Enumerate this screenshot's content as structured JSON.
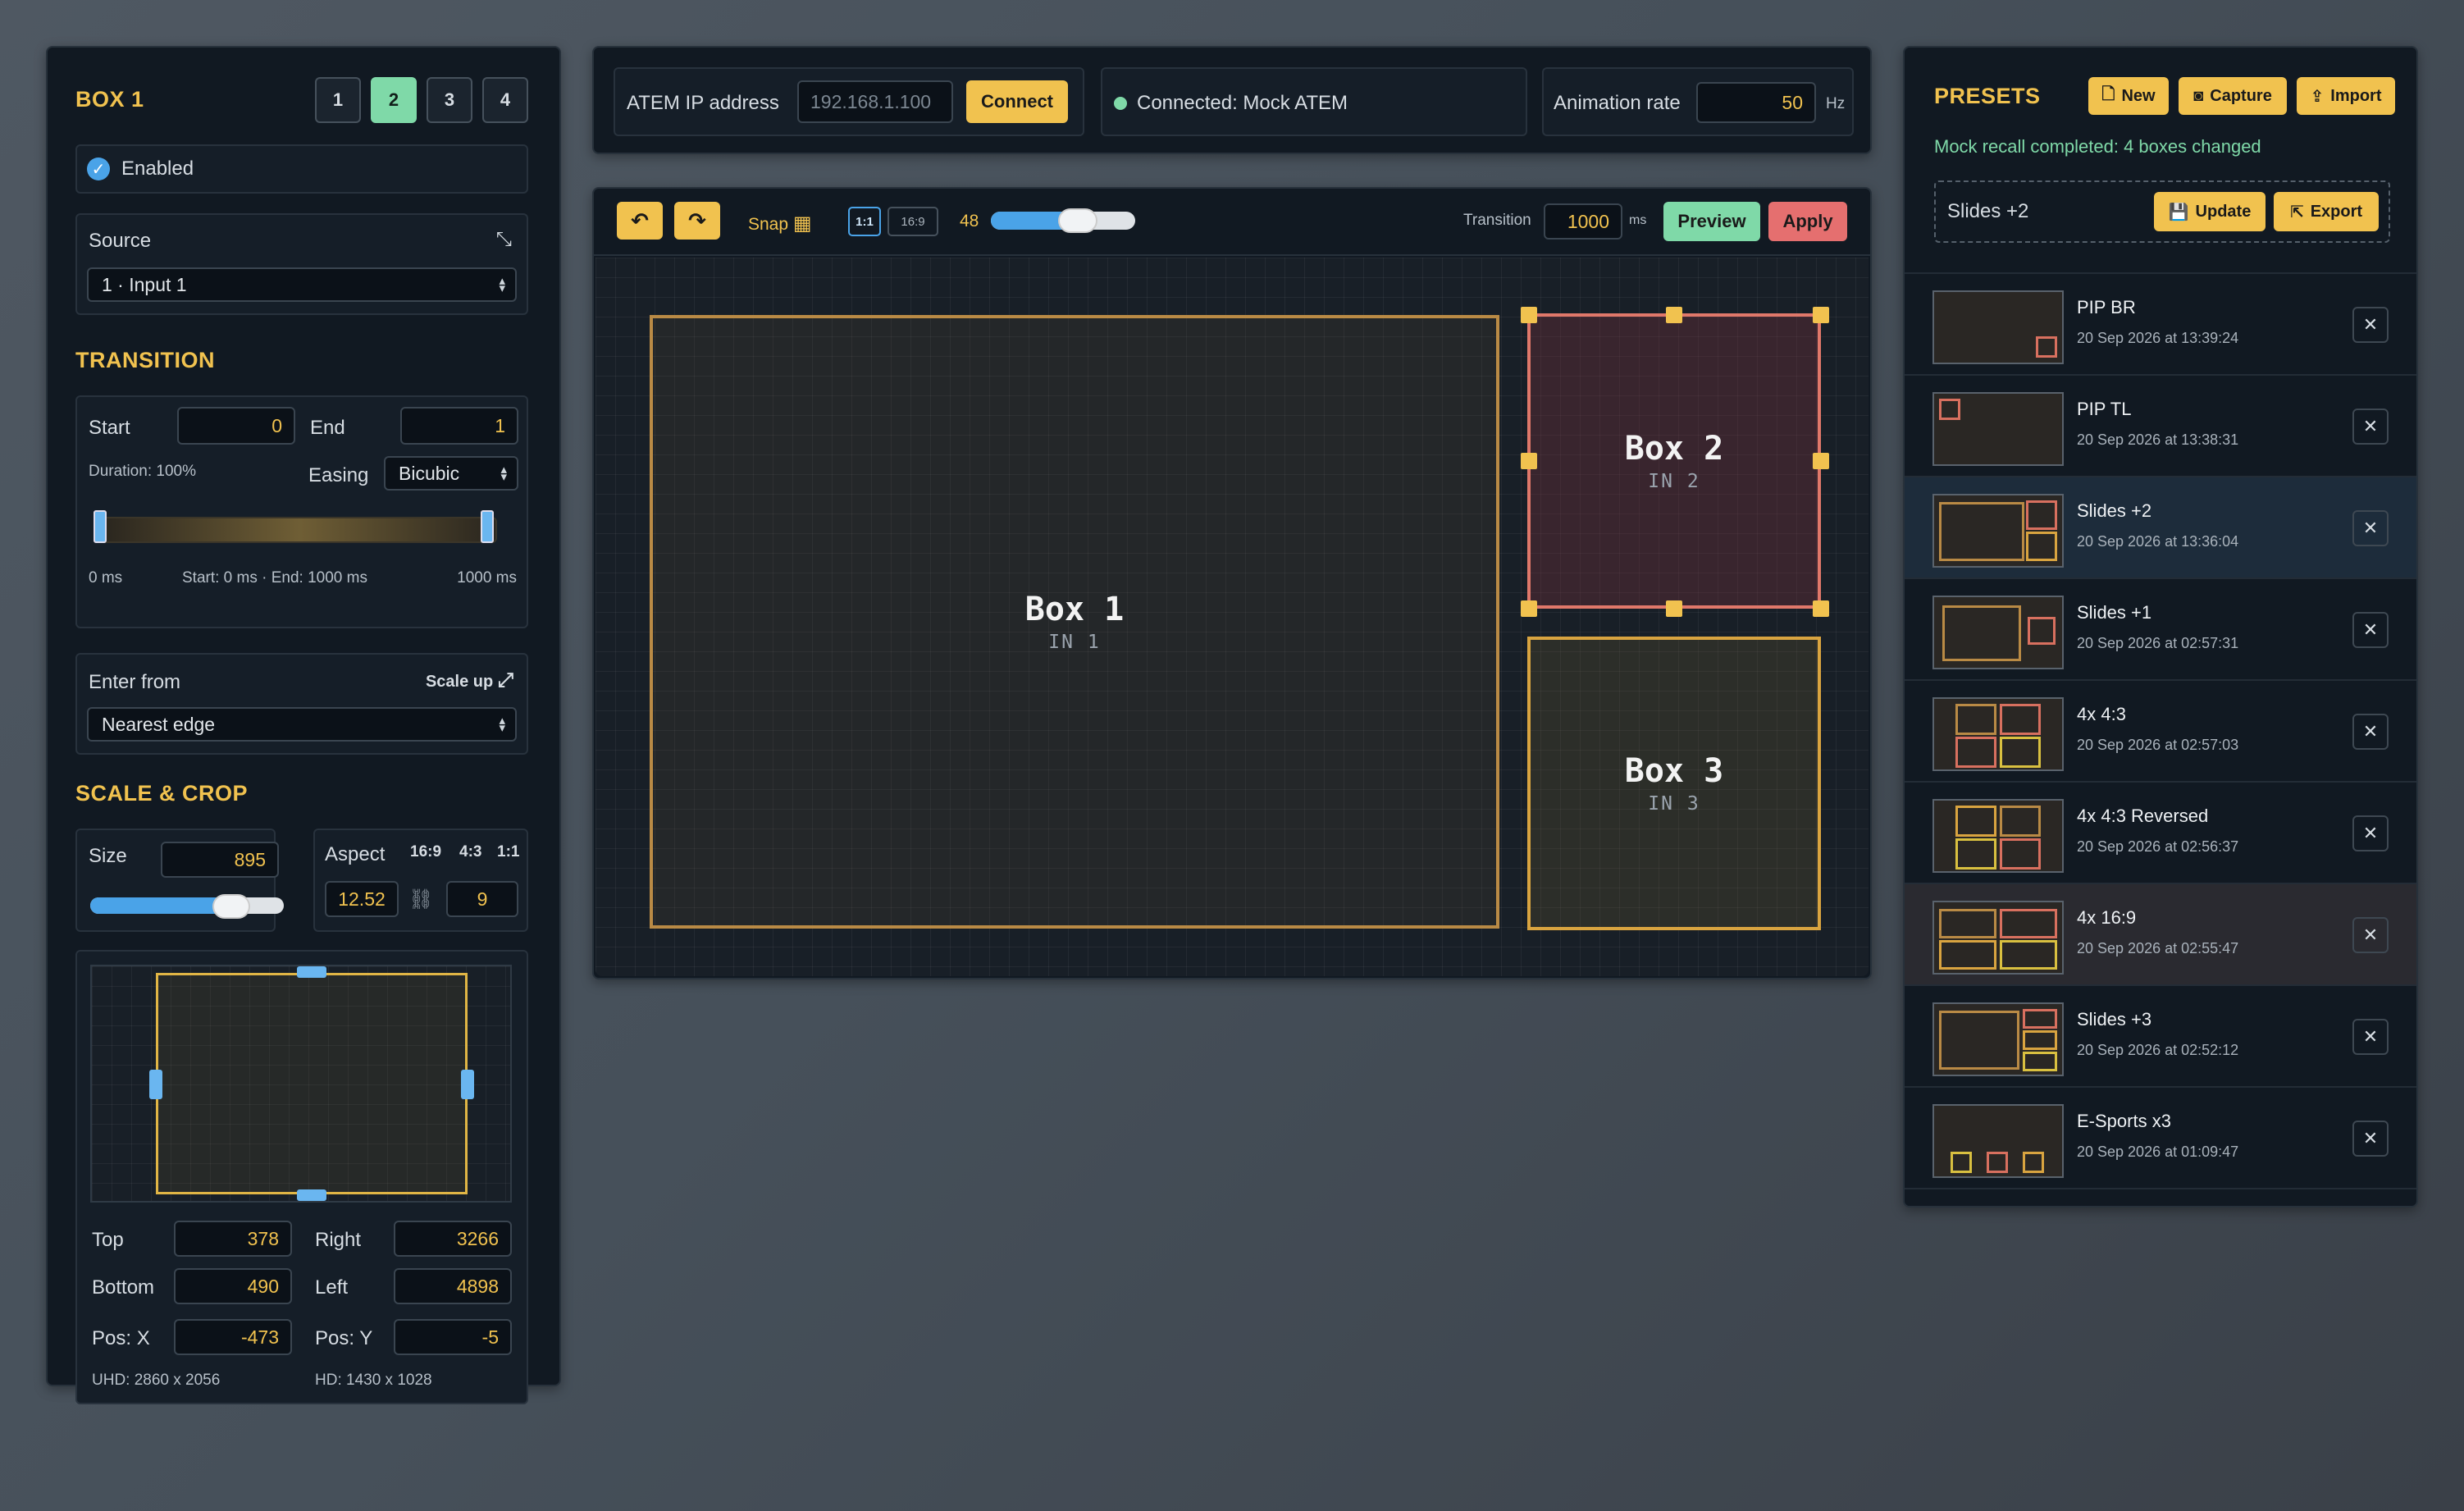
{
  "box_panel": {
    "title": "BOX 1",
    "tabs": [
      "1",
      "2",
      "3",
      "4"
    ],
    "enabled_label": "Enabled",
    "source_label": "Source",
    "source_value": "1 · Input 1"
  },
  "transition": {
    "title": "TRANSITION",
    "start_label": "Start",
    "start_value": "0",
    "end_label": "End",
    "end_value": "1",
    "duration": "Duration: 100%",
    "easing_label": "Easing",
    "easing_value": "Bicubic",
    "range_min": "0 ms",
    "range_mid": "Start: 0 ms · End: 1000 ms",
    "range_max": "1000 ms",
    "enter_label": "Enter from",
    "scale_up": "Scale up",
    "enter_value": "Nearest edge"
  },
  "scale_crop": {
    "title": "SCALE & CROP",
    "size_label": "Size",
    "size_value": "895",
    "size_level": 0.73,
    "aspect_label": "Aspect",
    "aspect_opts": [
      "16:9",
      "4:3",
      "1:1"
    ],
    "aspect_w": "12.52",
    "aspect_h": "9",
    "top_label": "Top",
    "top_value": "378",
    "right_label": "Right",
    "right_value": "3266",
    "bottom_label": "Bottom",
    "bottom_value": "490",
    "left_label": "Left",
    "left_value": "4898",
    "posx_label": "Pos: X",
    "posx_value": "-473",
    "posy_label": "Pos: Y",
    "posy_value": "-5",
    "uhd": "UHD: 2860 x 2056",
    "hd": "HD: 1430 x 1028"
  },
  "connection": {
    "ip_label": "ATEM IP address",
    "ip_placeholder": "192.168.1.100",
    "connect": "Connect",
    "status": "Connected: Mock ATEM",
    "rate_label": "Animation rate",
    "rate_value": "50",
    "rate_unit": "Hz"
  },
  "toolbar": {
    "snap": "Snap",
    "r11": "1:1",
    "r169": "16:9",
    "grid_value": "48",
    "grid_level": 0.6,
    "transition_label": "Transition",
    "transition_value": "1000",
    "transition_unit": "ms",
    "preview": "Preview",
    "apply": "Apply"
  },
  "canvas": {
    "boxes": [
      {
        "name": "Box 1",
        "input": "IN 1"
      },
      {
        "name": "Box 2",
        "input": "IN 2"
      },
      {
        "name": "Box 3",
        "input": "IN 3"
      }
    ]
  },
  "presets": {
    "title": "PRESETS",
    "new": "New",
    "capture": "Capture",
    "import": "Import",
    "status": "Mock recall completed: 4 boxes changed",
    "current": "Slides +2",
    "update": "Update",
    "export": "Export",
    "items": [
      {
        "name": "PIP BR",
        "date": "20 Sep 2026 at 13:39:24"
      },
      {
        "name": "PIP TL",
        "date": "20 Sep 2026 at 13:38:31"
      },
      {
        "name": "Slides +2",
        "date": "20 Sep 2026 at 13:36:04"
      },
      {
        "name": "Slides +1",
        "date": "20 Sep 2026 at 02:57:31"
      },
      {
        "name": "4x 4:3",
        "date": "20 Sep 2026 at 02:57:03"
      },
      {
        "name": "4x 4:3 Reversed",
        "date": "20 Sep 2026 at 02:56:37"
      },
      {
        "name": "4x 16:9",
        "date": "20 Sep 2026 at 02:55:47"
      },
      {
        "name": "Slides +3",
        "date": "20 Sep 2026 at 02:52:12"
      },
      {
        "name": "E-Sports x3",
        "date": "20 Sep 2026 at 01:09:47"
      }
    ]
  },
  "colors": {
    "accent": "#f1c24f",
    "green": "#7fd9a8",
    "red": "#e56f6f",
    "panel": "#111922"
  }
}
